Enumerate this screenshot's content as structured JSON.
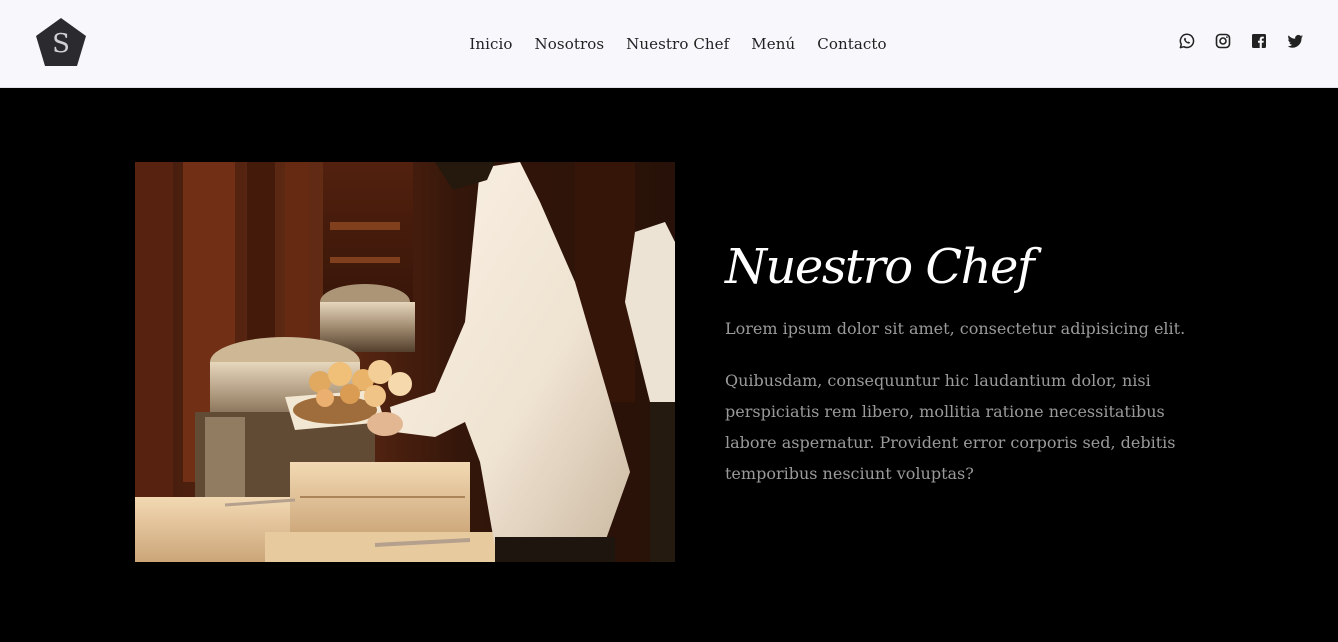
{
  "header": {
    "logo_letter": "S",
    "nav": [
      {
        "label": "Inicio"
      },
      {
        "label": "Nosotros"
      },
      {
        "label": "Nuestro Chef"
      },
      {
        "label": "Menú"
      },
      {
        "label": "Contacto"
      }
    ],
    "socials": [
      {
        "icon": "whatsapp-icon"
      },
      {
        "icon": "instagram-icon"
      },
      {
        "icon": "facebook-icon"
      },
      {
        "icon": "twitter-icon"
      }
    ]
  },
  "chef_section": {
    "title": "Nuestro Chef",
    "lead": "Lorem ipsum dolor sit amet, consectetur adipisicing elit.",
    "body": "Quibusdam, consequuntur hic laudantium dolor, nisi perspiciatis rem libero, mollitia ratione necessitatibus labore aspernatur. Provident error corporis sed, debitis temporibus nesciunt voluptas?",
    "image": "chef-serving-bread-photo"
  },
  "colors": {
    "header_bg": "#f8f8fc",
    "main_bg": "#000000",
    "title": "#ffffff",
    "body_text": "#9a9a9a",
    "logo_bg": "#2b2b2f"
  }
}
